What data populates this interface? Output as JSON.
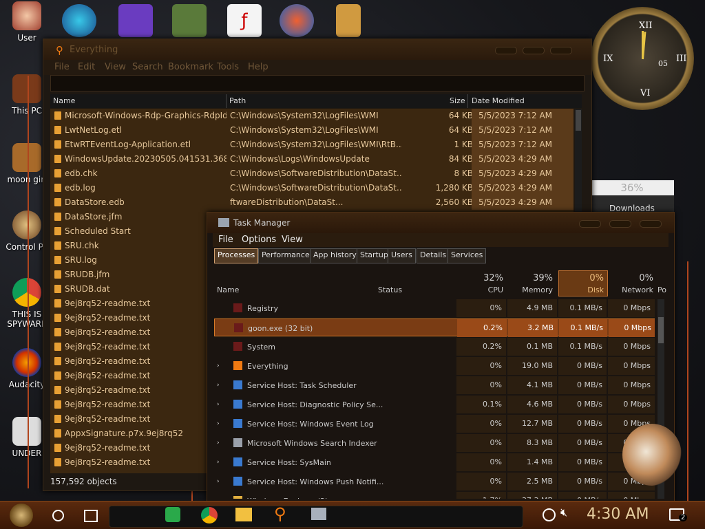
{
  "desktop": {
    "icons": [
      {
        "label": "User"
      },
      {
        "label": "This PC"
      },
      {
        "label": "moon girl"
      },
      {
        "label": "Control Pa"
      },
      {
        "label": "THIS IS SPYWARE"
      },
      {
        "label": "Audacity"
      },
      {
        "label": "UNDER"
      }
    ],
    "top_icons": [
      "swf-flash-icon",
      "chrome-edge-icon",
      "visual-studio-icon",
      "minecraft-block-icon",
      "pdf-p-icon",
      "document-icon"
    ]
  },
  "everything": {
    "title": "Everything",
    "menu": [
      "File",
      "Edit",
      "View",
      "Search",
      "Bookmark",
      "Tools",
      "Help"
    ],
    "columns": {
      "name": "Name",
      "path": "Path",
      "size": "Size",
      "date": "Date Modified"
    },
    "rows": [
      {
        "name": "Microsoft-Windows-Rdp-Graphics-RdpId...",
        "path": "C:\\Windows\\System32\\LogFiles\\WMI",
        "size": "64 KB",
        "date": "5/5/2023 7:12 AM"
      },
      {
        "name": "LwtNetLog.etl",
        "path": "C:\\Windows\\System32\\LogFiles\\WMI",
        "size": "64 KB",
        "date": "5/5/2023 7:12 AM"
      },
      {
        "name": "EtwRTEventLog-Application.etl",
        "path": "C:\\Windows\\System32\\LogFiles\\WMI\\RtB...",
        "size": "1 KB",
        "date": "5/5/2023 7:12 AM"
      },
      {
        "name": "WindowsUpdate.20230505.041531.368.3...",
        "path": "C:\\Windows\\Logs\\WindowsUpdate",
        "size": "84 KB",
        "date": "5/5/2023 4:29 AM"
      },
      {
        "name": "edb.chk",
        "path": "C:\\Windows\\SoftwareDistribution\\DataSt...",
        "size": "8 KB",
        "date": "5/5/2023 4:29 AM"
      },
      {
        "name": "edb.log",
        "path": "C:\\Windows\\SoftwareDistribution\\DataSt...",
        "size": "1,280 KB",
        "date": "5/5/2023 4:29 AM"
      },
      {
        "name": "DataStore.edb",
        "path": "ftwareDistribution\\DataSt...",
        "size": "2,560 KB",
        "date": "5/5/2023 4:29 AM"
      },
      {
        "name": "DataStore.jfm",
        "path": "",
        "size": "",
        "date": ""
      },
      {
        "name": "Scheduled Start",
        "path": "",
        "size": "",
        "date": ""
      },
      {
        "name": "SRU.chk",
        "path": "",
        "size": "",
        "date": ""
      },
      {
        "name": "SRU.log",
        "path": "",
        "size": "",
        "date": ""
      },
      {
        "name": "SRUDB.jfm",
        "path": "",
        "size": "",
        "date": ""
      },
      {
        "name": "SRUDB.dat",
        "path": "",
        "size": "",
        "date": ""
      },
      {
        "name": "9ej8rq52-readme.txt",
        "path": "",
        "size": "",
        "date": ""
      },
      {
        "name": "9ej8rq52-readme.txt",
        "path": "",
        "size": "",
        "date": ""
      },
      {
        "name": "9ej8rq52-readme.txt",
        "path": "",
        "size": "",
        "date": ""
      },
      {
        "name": "9ej8rq52-readme.txt",
        "path": "",
        "size": "",
        "date": ""
      },
      {
        "name": "9ej8rq52-readme.txt",
        "path": "",
        "size": "",
        "date": ""
      },
      {
        "name": "9ej8rq52-readme.txt",
        "path": "",
        "size": "",
        "date": ""
      },
      {
        "name": "9ej8rq52-readme.txt",
        "path": "",
        "size": "",
        "date": ""
      },
      {
        "name": "9ej8rq52-readme.txt",
        "path": "",
        "size": "",
        "date": ""
      },
      {
        "name": "9ej8rq52-readme.txt",
        "path": "",
        "size": "",
        "date": ""
      },
      {
        "name": "AppxSignature.p7x.9ej8rq52",
        "path": "",
        "size": "",
        "date": ""
      },
      {
        "name": "9ej8rq52-readme.txt",
        "path": "",
        "size": "",
        "date": ""
      },
      {
        "name": "9ej8rq52-readme.txt",
        "path": "",
        "size": "",
        "date": ""
      }
    ],
    "status": "157,592 objects"
  },
  "downloads_window": {
    "percent": "36%",
    "label": "Downloads"
  },
  "taskmanager": {
    "title": "Task Manager",
    "menu": [
      "File",
      "Options",
      "View"
    ],
    "tabs": [
      "Processes",
      "Performance",
      "App history",
      "Startup",
      "Users",
      "Details",
      "Services"
    ],
    "active_tab": "Processes",
    "columns": {
      "name": "Name",
      "status": "Status",
      "cpu_pct": "32%",
      "cpu": "CPU",
      "mem_pct": "39%",
      "mem": "Memory",
      "disk_pct": "0%",
      "disk": "Disk",
      "net_pct": "0%",
      "net": "Network",
      "power": "Po"
    },
    "processes": [
      {
        "name": "Registry",
        "cpu": "0%",
        "mem": "4.9 MB",
        "disk": "0.1 MB/s",
        "net": "0 Mbps",
        "icon": "registry-icon",
        "expand": ""
      },
      {
        "name": "goon.exe (32 bit)",
        "cpu": "0.2%",
        "mem": "3.2 MB",
        "disk": "0.1 MB/s",
        "net": "0 Mbps",
        "icon": "app-icon",
        "expand": ""
      },
      {
        "name": "System",
        "cpu": "0.2%",
        "mem": "0.1 MB",
        "disk": "0.1 MB/s",
        "net": "0 Mbps",
        "icon": "system-icon",
        "expand": ""
      },
      {
        "name": "Everything",
        "cpu": "0%",
        "mem": "19.0 MB",
        "disk": "0 MB/s",
        "net": "0 Mbps",
        "icon": "search-icon",
        "expand": "›"
      },
      {
        "name": "Service Host: Task Scheduler",
        "cpu": "0%",
        "mem": "4.1 MB",
        "disk": "0 MB/s",
        "net": "0 Mbps",
        "icon": "gear-icon",
        "expand": "›"
      },
      {
        "name": "Service Host: Diagnostic Policy Se...",
        "cpu": "0.1%",
        "mem": "4.6 MB",
        "disk": "0 MB/s",
        "net": "0 Mbps",
        "icon": "gear-icon",
        "expand": "›"
      },
      {
        "name": "Service Host: Windows Event Log",
        "cpu": "0%",
        "mem": "12.7 MB",
        "disk": "0 MB/s",
        "net": "0 Mbps",
        "icon": "gear-icon",
        "expand": "›"
      },
      {
        "name": "Microsoft Windows Search Indexer",
        "cpu": "0%",
        "mem": "8.3 MB",
        "disk": "0 MB/s",
        "net": "0 Mbps",
        "icon": "user-icon",
        "expand": "›"
      },
      {
        "name": "Service Host: SysMain",
        "cpu": "0%",
        "mem": "1.4 MB",
        "disk": "0 MB/s",
        "net": "0 Mbps",
        "icon": "gear-icon",
        "expand": "›"
      },
      {
        "name": "Service Host: Windows Push Notifi...",
        "cpu": "0%",
        "mem": "2.5 MB",
        "disk": "0 MB/s",
        "net": "0 Mbps",
        "icon": "gear-icon",
        "expand": "›"
      },
      {
        "name": "Windows Explorer (2)",
        "cpu": "1.7%",
        "mem": "37.3 MB",
        "disk": "0 MB/s",
        "net": "0 Mbps",
        "icon": "folder-icon",
        "expand": "›"
      }
    ],
    "selected_index": 1
  },
  "clock_widget": {
    "date": "05"
  },
  "taskbar": {
    "time": "4:30 AM",
    "notification_count": "2",
    "pinned": [
      "start-gear-icon",
      "cortana-circle-icon",
      "task-view-icon",
      "google-chat-icon",
      "chrome-icon",
      "file-explorer-icon",
      "everything-search-icon",
      "task-manager-icon"
    ],
    "colors": {
      "accent": "#f07a12",
      "bar": "#4a2008"
    }
  }
}
